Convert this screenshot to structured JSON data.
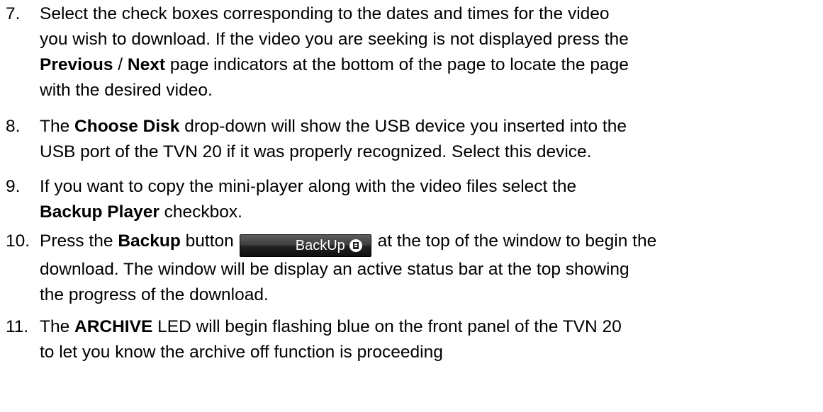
{
  "steps": [
    {
      "number": "7.",
      "l1": "Select the check boxes corresponding to the dates and times for the video",
      "l2": "you wish to download.  If the video you are seeking is not displayed press the",
      "l3_b1": "Previous",
      "l3_sep": " / ",
      "l3_b2": "Next",
      "l3_rest": " page indicators at the bottom of the page to locate the page",
      "l4": "with the desired video."
    },
    {
      "number": "8.",
      "l1_pre": "The ",
      "l1_b": "Choose Disk",
      "l1_post": " drop-down will show the USB device you inserted into the",
      "l2": "USB port of the TVN 20 if it was properly recognized.  Select this device."
    },
    {
      "number": "9.",
      "l1": "If you want to copy the mini-player along with the video files select the",
      "l2_b": "Backup Player",
      "l2_post": " checkbox."
    },
    {
      "number": "10.",
      "l1_pre": "Press the ",
      "l1_b": "Backup",
      "l1_mid": " button",
      "button_label": "BackUp",
      "button_icon": "disk-save-icon",
      "l1_post": " at the top of the window to begin the",
      "l2": "download.  The window will be display an active status bar at the top showing",
      "l3": "the progress of the download."
    },
    {
      "number": "11.",
      "l1_pre": "The ",
      "l1_b": "ARCHIVE",
      "l1_post": " LED will begin flashing blue on the front panel of the TVN 20",
      "l2": "to let you know the archive off function is proceeding"
    }
  ]
}
